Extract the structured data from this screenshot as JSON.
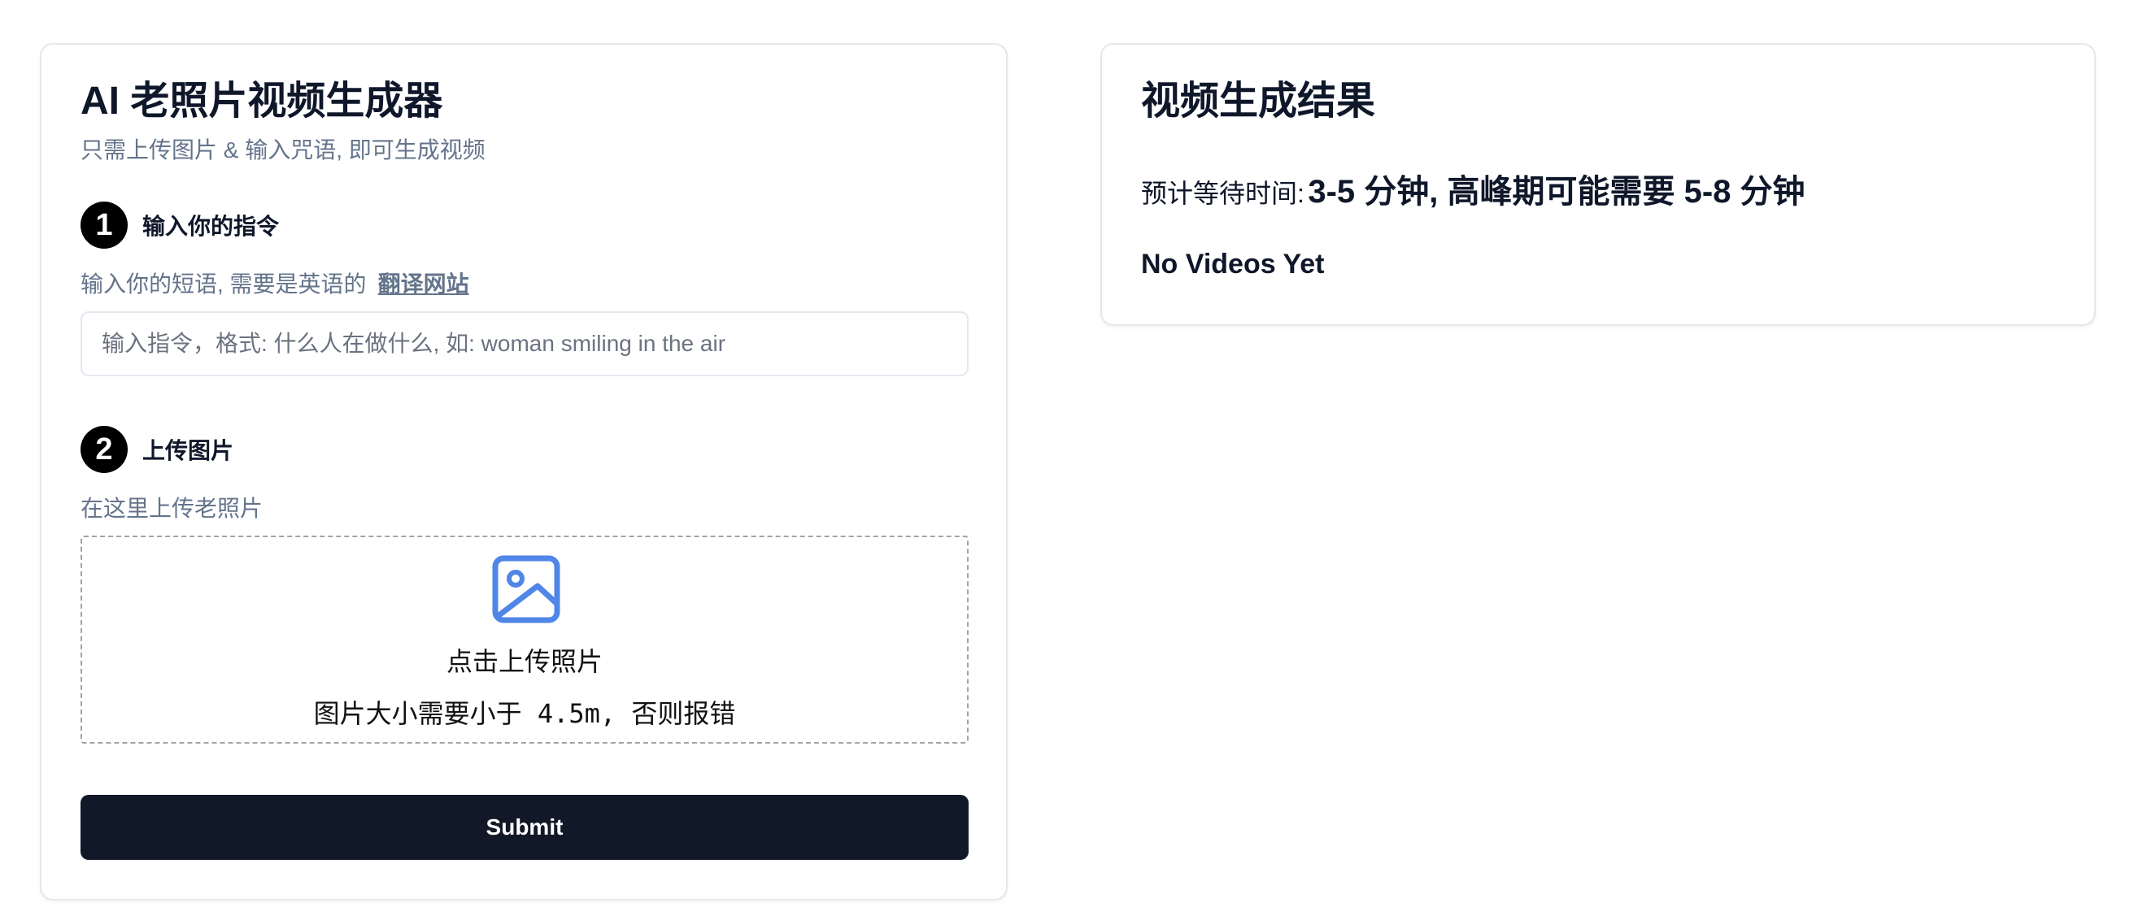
{
  "generator": {
    "title": "AI 老照片视频生成器",
    "subtitle": "只需上传图片 & 输入咒语, 即可生成视频",
    "step1": {
      "number": "1",
      "title": "输入你的指令",
      "hint": "输入你的短语, 需要是英语的",
      "link_label": "翻译网站",
      "input_placeholder": "输入指令，格式: 什么人在做什么, 如: woman smiling in the air",
      "input_value": ""
    },
    "step2": {
      "number": "2",
      "title": "上传图片",
      "hint": "在这里上传老照片",
      "upload_icon": "image-icon",
      "upload_label": "点击上传照片",
      "size_note": "图片大小需要小于 4.5m, 否则报错"
    },
    "submit_label": "Submit"
  },
  "result": {
    "title": "视频生成结果",
    "wait_label": "预计等待时间:",
    "wait_value": "3-5 分钟, 高峰期可能需要 5-8 分钟",
    "empty_text": "No Videos Yet"
  },
  "colors": {
    "accent_icon": "#4f86e7",
    "button_bg": "#111827",
    "muted_text": "#64748b",
    "border": "#e5e7eb"
  }
}
